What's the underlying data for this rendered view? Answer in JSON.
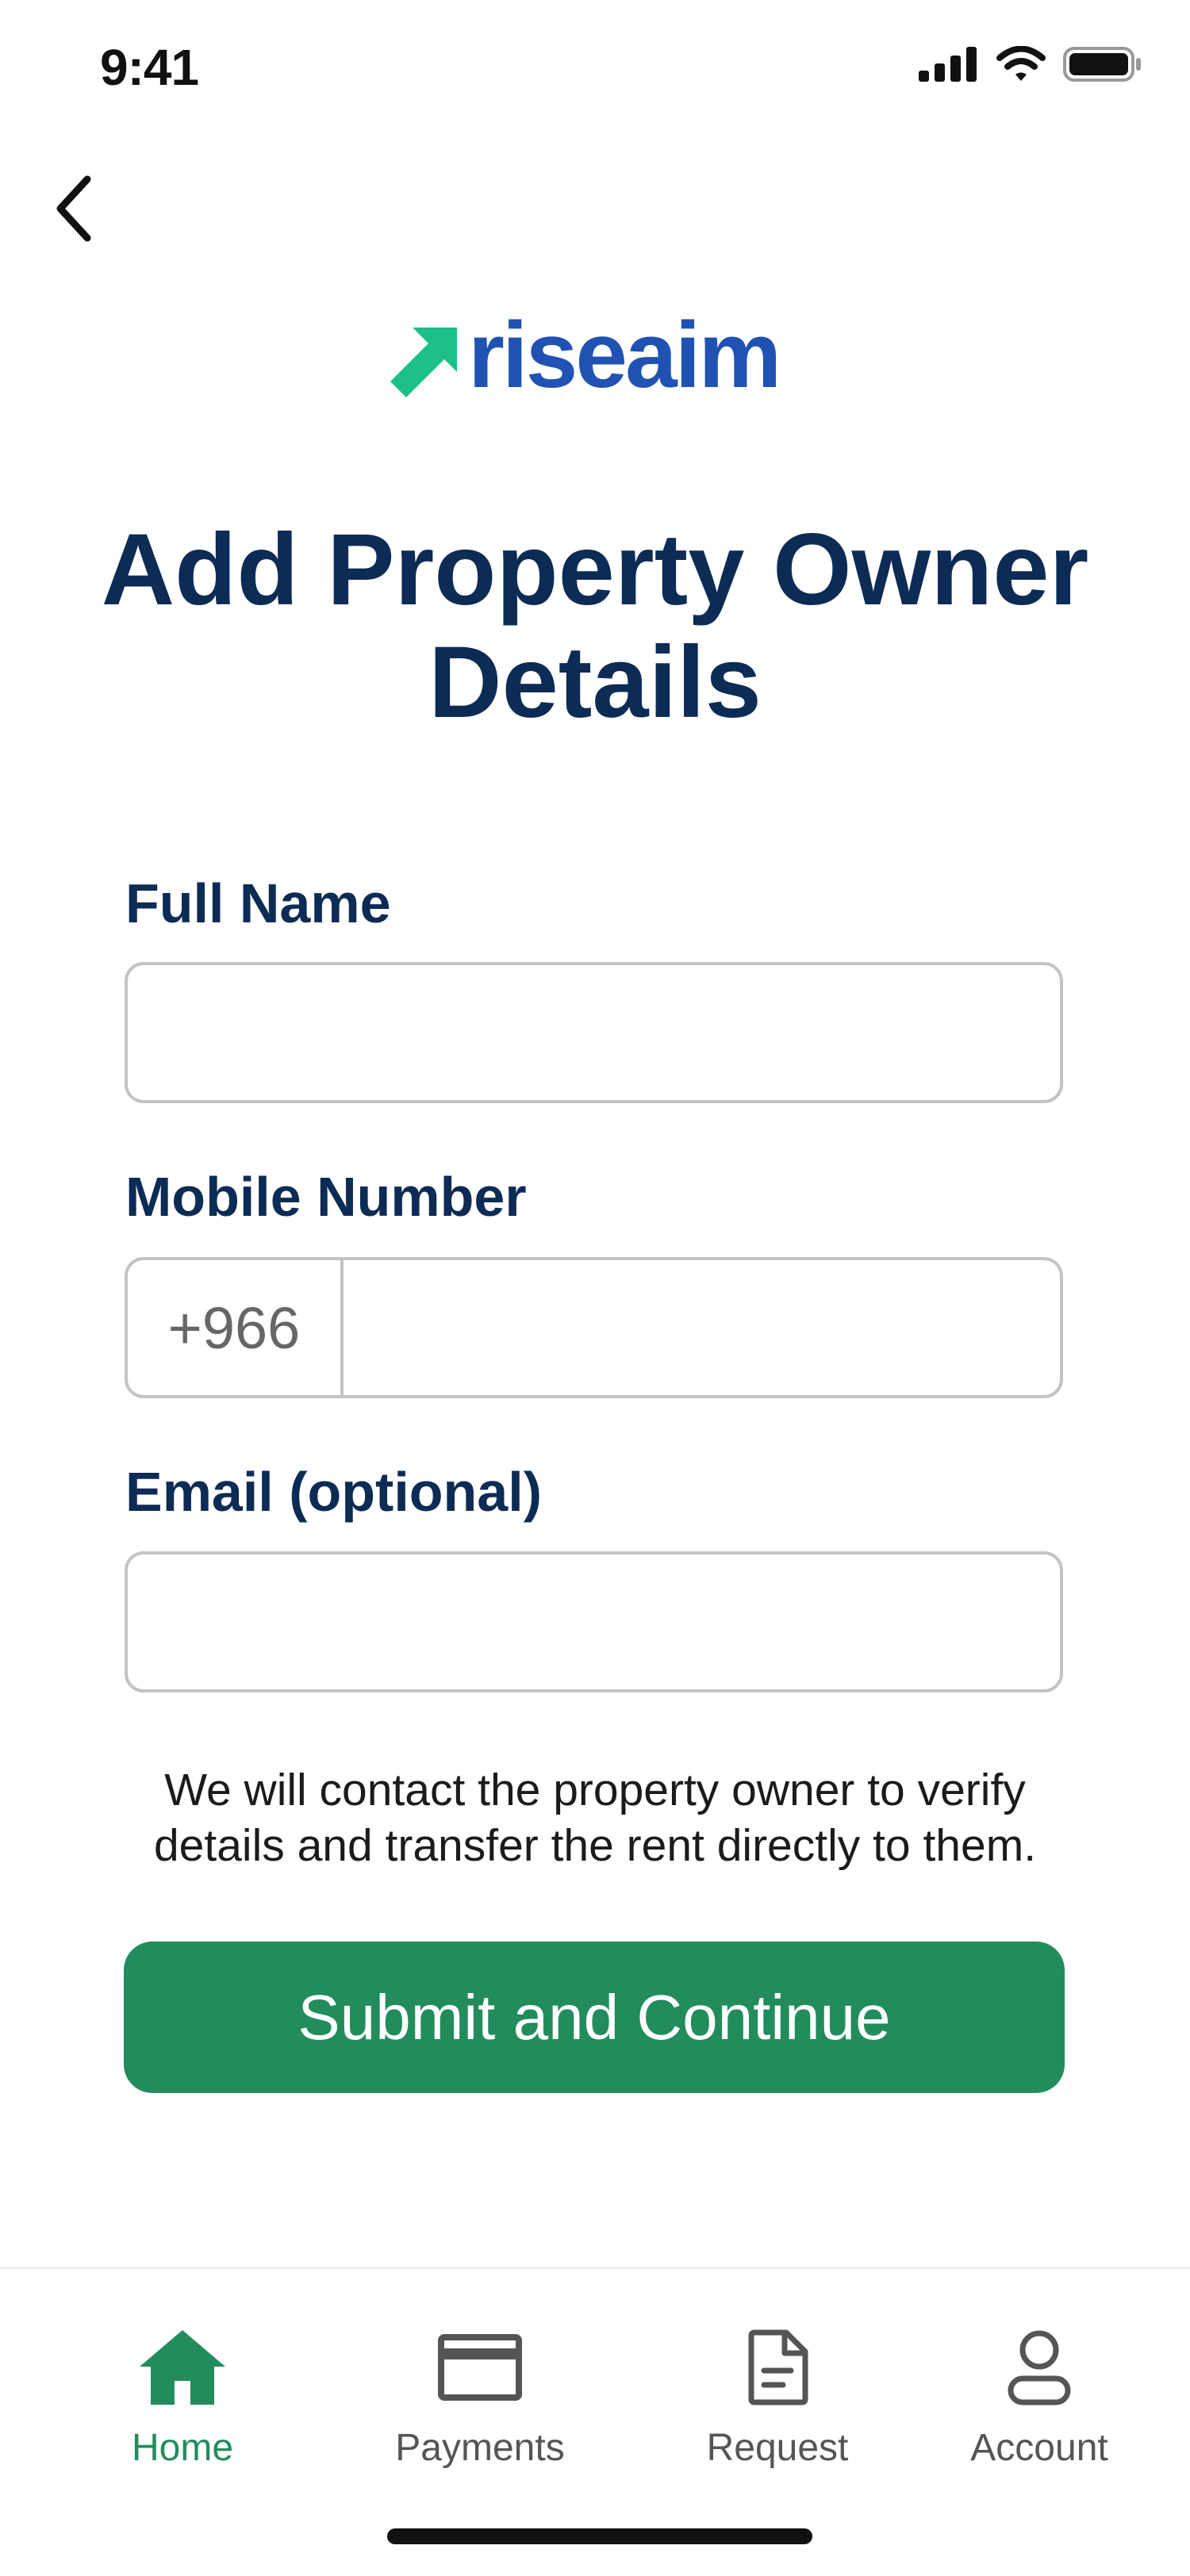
{
  "status_bar": {
    "time": "9:41"
  },
  "header": {
    "back_icon": "chevron-left-icon",
    "logo_text": "riseaim"
  },
  "title": "Add Property Owner Details",
  "form": {
    "full_name": {
      "label": "Full Name",
      "value": ""
    },
    "mobile": {
      "label": "Mobile Number",
      "country_code": "+966",
      "value": ""
    },
    "email": {
      "label": "Email (optional)",
      "value": ""
    }
  },
  "info_text": "We will contact the property owner to verify details and transfer the rent directly to them.",
  "submit_label": "Submit and Continue",
  "tabs": [
    {
      "label": "Home",
      "icon": "home-icon",
      "active": true
    },
    {
      "label": "Payments",
      "icon": "card-icon",
      "active": false
    },
    {
      "label": "Request",
      "icon": "document-icon",
      "active": false
    },
    {
      "label": "Account",
      "icon": "user-icon",
      "active": false
    }
  ],
  "colors": {
    "brand_blue": "#1f52b3",
    "brand_green": "#228c5c",
    "logo_arrow": "#1cbf8a",
    "title_navy": "#0c2b55"
  }
}
